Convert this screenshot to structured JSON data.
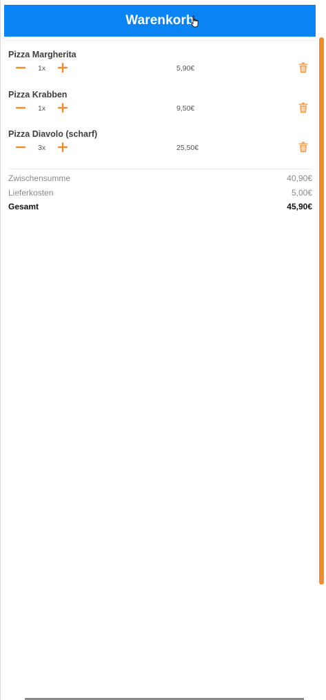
{
  "header": {
    "title": "Warenkorb"
  },
  "cart": {
    "items": [
      {
        "name": "Pizza Margherita",
        "quantity": "1x",
        "price": "5,90€"
      },
      {
        "name": "Pizza Krabben",
        "quantity": "1x",
        "price": "9,50€"
      },
      {
        "name": "Pizza Diavolo (scharf)",
        "quantity": "3x",
        "price": "25,50€"
      }
    ]
  },
  "summary": {
    "subtotal_label": "Zwischensumme",
    "subtotal_value": "40,90€",
    "delivery_label": "Lieferkosten",
    "delivery_value": "5,00€",
    "total_label": "Gesamt",
    "total_value": "45,90€"
  },
  "colors": {
    "header": "#0a84f5",
    "accent": "#f08c2c"
  },
  "icons": [
    "minus-icon",
    "plus-icon",
    "trash-icon",
    "hand-cursor-icon"
  ]
}
